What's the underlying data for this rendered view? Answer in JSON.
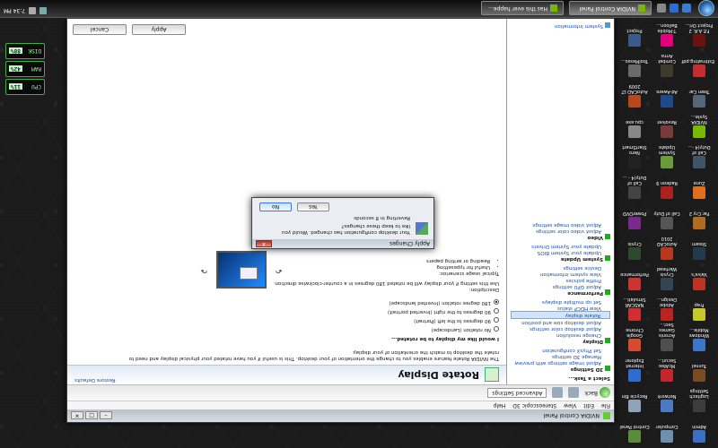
{
  "taskbar": {
    "tasks": [
      {
        "label": "NVIDIA Control Panel",
        "active": true
      },
      {
        "label": "Has this ever happe...",
        "active": false
      }
    ],
    "tray_time": "7:34 PM"
  },
  "desktop_icons": [
    {
      "label": "Admin",
      "color": "#3a6fc4"
    },
    {
      "label": "Computer",
      "color": "#6e8fb0"
    },
    {
      "label": "Control Panel",
      "color": "#5b8c3a"
    },
    {
      "label": "Logitech Settings",
      "color": "#3d3d3d"
    },
    {
      "label": "Network",
      "color": "#4a7bc2"
    },
    {
      "label": "Recycle Bin",
      "color": "#8fa3b8"
    },
    {
      "label": "Tunnel",
      "color": "#7a4a22"
    },
    {
      "label": "McAfee Securi...",
      "color": "#c4262e"
    },
    {
      "label": "Internet Explorer",
      "color": "#2e6cd1"
    },
    {
      "label": "Windows Mobile...",
      "color": "#3b77c6"
    },
    {
      "label": "Acronis Games Secr...",
      "color": "#4f4f4f"
    },
    {
      "label": "Google Chrome",
      "color": "#d64a2f"
    },
    {
      "label": "Frap",
      "color": "#c8c82c"
    },
    {
      "label": "Adobe Design...",
      "color": "#b22"
    },
    {
      "label": "NASCAR Simulati...",
      "color": "#d12f2f"
    },
    {
      "label": "Valve's",
      "color": "#bb3322"
    },
    {
      "label": "Crysis Warhead",
      "color": "#334455"
    },
    {
      "label": "Performance",
      "color": "#c33"
    },
    {
      "label": "Steam",
      "color": "#22394e"
    },
    {
      "label": "AutoCAD 2010",
      "color": "#b53a1c"
    },
    {
      "label": "Crysis",
      "color": "#2d4a2d"
    },
    {
      "label": "Far Cry 2",
      "color": "#b06a22"
    },
    {
      "label": "Call of Duty",
      "color": "#555"
    },
    {
      "label": "PowerDVD",
      "color": "#7a2a8a"
    },
    {
      "label": "Zune",
      "color": "#e07020"
    },
    {
      "label": "Radeon 9",
      "color": "#aa2222"
    },
    {
      "label": "Call of Duty(4 - ...",
      "color": "#444"
    },
    {
      "label": "Call of Duty(4 -...",
      "color": "#3d5566"
    },
    {
      "label": "System Update",
      "color": "#6a9a3a"
    },
    {
      "label": "Nero StartSmart",
      "color": "#222"
    },
    {
      "label": "NVIDIA Syste...",
      "color": "#76b900"
    },
    {
      "label": "Revolver",
      "color": "#7a3a3a"
    },
    {
      "label": "cpu.exe",
      "color": "#888"
    },
    {
      "label": "Town Car",
      "color": "#556677"
    },
    {
      "label": "Ad-Aware",
      "color": "#1e4a8a"
    },
    {
      "label": "AutoCAD LT 2009",
      "color": "#b5481c"
    },
    {
      "label": "Estimating.pdf",
      "color": "#c42e2e"
    },
    {
      "label": "Combat Arms",
      "color": "#3b3b2b"
    },
    {
      "label": "ToolMesso...",
      "color": "#6a6a6a"
    },
    {
      "label": "F.E.A.R. 2 Project Ori...",
      "color": "#6a1111"
    },
    {
      "label": "T-Mobile Balloon...",
      "color": "#e2007a"
    },
    {
      "label": "Project",
      "color": "#3a5a8a"
    }
  ],
  "gadgets": [
    {
      "label": "CPU",
      "value": "11%"
    },
    {
      "label": "RAM",
      "value": "42%"
    },
    {
      "label": "DISK",
      "value": "88%"
    }
  ],
  "window": {
    "title": "NVIDIA Control Panel",
    "menu": [
      "File",
      "Edit",
      "View",
      "Stereoscopic 3D",
      "Help"
    ],
    "toolbar": {
      "back": "Back",
      "advanced_settings": "Advanced Settings"
    },
    "tree": {
      "heading": "Select a Task...",
      "groups": [
        {
          "name": "3D Settings",
          "items": [
            {
              "label": "Adjust image settings with preview",
              "selected": false
            },
            {
              "label": "Manage 3D settings",
              "selected": false
            },
            {
              "label": "Set PhysX configuration",
              "selected": false
            }
          ]
        },
        {
          "name": "Display",
          "items": [
            {
              "label": "Change resolution",
              "selected": false
            },
            {
              "label": "Adjust desktop color settings",
              "selected": false
            },
            {
              "label": "Adjust desktop size and position",
              "selected": false
            },
            {
              "label": "Rotate display",
              "selected": true
            },
            {
              "label": "View HDCP status",
              "selected": false
            },
            {
              "label": "Set up multiple displays",
              "selected": false
            }
          ]
        },
        {
          "name": "Performance",
          "items": [
            {
              "label": "Adjust GPU settings",
              "selected": false
            },
            {
              "label": "Profile policies",
              "selected": false
            },
            {
              "label": "View system information",
              "selected": false
            },
            {
              "label": "Device settings",
              "selected": false
            }
          ]
        },
        {
          "name": "System Update",
          "items": [
            {
              "label": "Update your System BIOS",
              "selected": false
            },
            {
              "label": "Update your System Drivers",
              "selected": false
            }
          ]
        },
        {
          "name": "Video",
          "items": [
            {
              "label": "Adjust video color settings",
              "selected": false
            },
            {
              "label": "Adjust video image settings",
              "selected": false
            }
          ]
        }
      ],
      "system_information": "System Information"
    },
    "panel": {
      "title": "Rotate Display",
      "restore_defaults": "Restore Defaults",
      "intro": "The NVIDIA Rotate feature enables you to change the orientation of your desktop. This is useful if you have rotated your physical display and need to rotate the desktop to match the orientation of your display.",
      "question": "I would like my display to be rotated...",
      "options": [
        {
          "label": "No rotation (Landscape)",
          "selected": false
        },
        {
          "label": "90 degrees to the left (Portrait)",
          "selected": false
        },
        {
          "label": "90 degrees to the right (Inverted portrait)",
          "selected": false
        },
        {
          "label": "180 degree rotation (Inverted landscape)",
          "selected": true
        }
      ],
      "description_label": "Description:",
      "description": "Use this setting if your display will be rotated 180 degrees in a counter-clockwise direction.",
      "usage_label": "Typical usage scenarios:",
      "usage": [
        "Useful for typesetting",
        "Reading or writing papers"
      ],
      "apply": "Apply",
      "cancel": "Cancel"
    }
  },
  "dialog": {
    "title": "Apply Changes",
    "close": "x",
    "message": "Your desktop configuration has changed. Would you like to keep these changes?",
    "countdown": "Reverting in 8 seconds",
    "yes": "Yes",
    "no": "No"
  }
}
